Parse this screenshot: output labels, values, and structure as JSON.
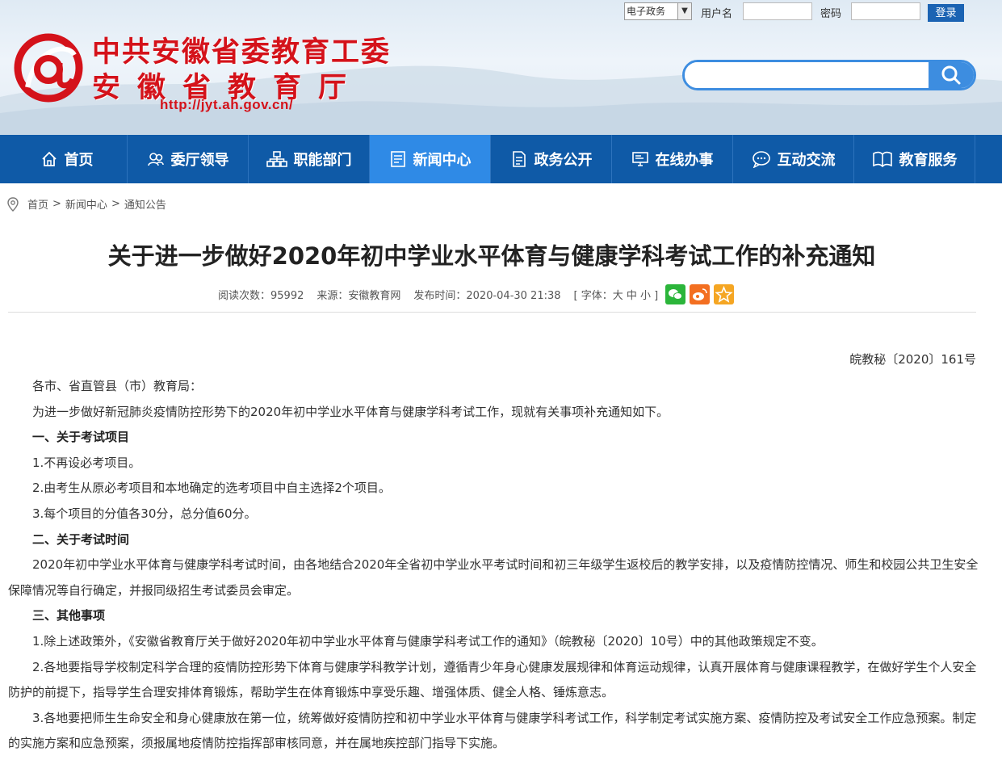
{
  "header": {
    "logo_line1": "中共安徽省委教育工委",
    "logo_line2": "安徽省教育厅",
    "logo_url": "http://jyt.ah.gov.cn/"
  },
  "login": {
    "select_value": "电子政务",
    "username_label": "用户名",
    "password_label": "密码",
    "login_button": "登录"
  },
  "nav": {
    "items": [
      {
        "label": "首页",
        "icon": "home-icon"
      },
      {
        "label": "委厅领导",
        "icon": "leaders-icon"
      },
      {
        "label": "职能部门",
        "icon": "org-chart-icon"
      },
      {
        "label": "新闻中心",
        "icon": "news-icon"
      },
      {
        "label": "政务公开",
        "icon": "document-icon"
      },
      {
        "label": "在线办事",
        "icon": "monitor-icon"
      },
      {
        "label": "互动交流",
        "icon": "chat-icon"
      },
      {
        "label": "教育服务",
        "icon": "book-icon"
      }
    ],
    "active_index": 3
  },
  "breadcrumb": {
    "home": "首页",
    "sep1": ">",
    "section": "新闻中心",
    "sep2": ">",
    "current": "通知公告"
  },
  "article": {
    "title": "关于进一步做好2020年初中学业水平体育与健康学科考试工作的补充通知",
    "meta": {
      "views": "阅读次数：95992",
      "source": "来源：安徽教育网",
      "published": "发布时间：2020-04-30 21:38",
      "font_size": "[ 字体：大 中 小 ]"
    },
    "doc_number": "皖教秘〔2020〕161号",
    "paragraphs": [
      {
        "text": "各市、省直管县（市）教育局：",
        "heading": false
      },
      {
        "text": "为进一步做好新冠肺炎疫情防控形势下的2020年初中学业水平体育与健康学科考试工作，现就有关事项补充通知如下。",
        "heading": false
      },
      {
        "text": "一、关于考试项目",
        "heading": true
      },
      {
        "text": "1.不再设必考项目。",
        "heading": false
      },
      {
        "text": "2.由考生从原必考项目和本地确定的选考项目中自主选择2个项目。",
        "heading": false
      },
      {
        "text": "3.每个项目的分值各30分，总分值60分。",
        "heading": false
      },
      {
        "text": "二、关于考试时间",
        "heading": true
      },
      {
        "text": "2020年初中学业水平体育与健康学科考试时间，由各地结合2020年全省初中学业水平考试时间和初三年级学生返校后的教学安排，以及疫情防控情况、师生和校园公共卫生安全保障情况等自行确定，并报同级招生考试委员会审定。",
        "heading": false
      },
      {
        "text": "三、其他事项",
        "heading": true
      },
      {
        "text": "1.除上述政策外，《安徽省教育厅关于做好2020年初中学业水平体育与健康学科考试工作的通知》（皖教秘〔2020〕10号）中的其他政策规定不变。",
        "heading": false
      },
      {
        "text": "2.各地要指导学校制定科学合理的疫情防控形势下体育与健康学科教学计划，遵循青少年身心健康发展规律和体育运动规律，认真开展体育与健康课程教学，在做好学生个人安全防护的前提下，指导学生合理安排体育锻炼，帮助学生在体育锻炼中享受乐趣、增强体质、健全人格、锤炼意志。",
        "heading": false
      },
      {
        "text": "3.各地要把师生生命安全和身心健康放在第一位，统筹做好疫情防控和初中学业水平体育与健康学科考试工作，科学制定考试实施方案、疫情防控及考试安全工作应急预案。制定的实施方案和应急预案，须报属地疫情防控指挥部审核同意，并在属地疾控部门指导下实施。",
        "heading": false
      }
    ]
  },
  "colors": {
    "brand_red": "#d4121a",
    "nav_blue": "#0f5aa7",
    "nav_active": "#2f8ae6",
    "search_blue": "#3d8de0",
    "wechat_green": "#2bb53a",
    "weibo_orange": "#f36f21",
    "favorite_orange": "#f5a623"
  }
}
